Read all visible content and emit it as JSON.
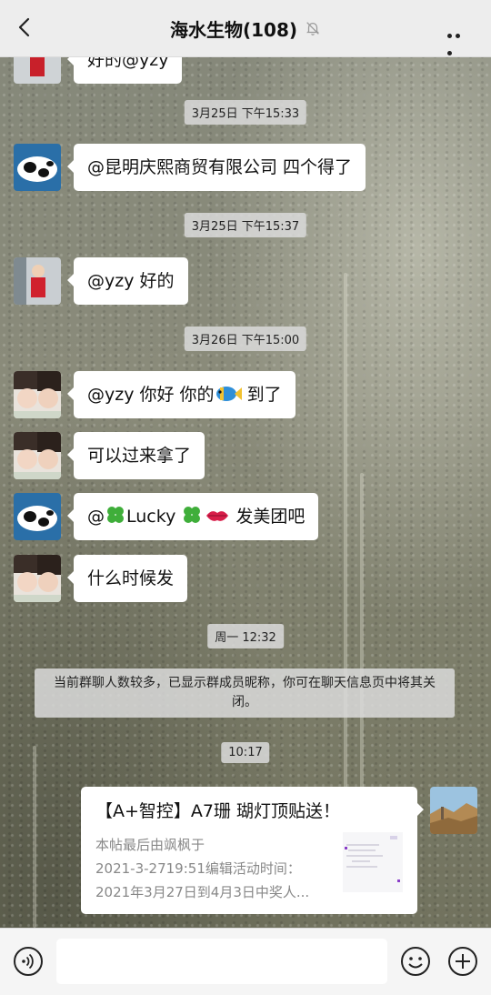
{
  "header": {
    "title": "海水生物(108)"
  },
  "messages": {
    "partial_text": "好的@yzy",
    "ts1": "3月25日 下午15:33",
    "m1": "@昆明庆熙商贸有限公司  四个得了",
    "ts2": "3月25日 下午15:37",
    "m2": "@yzy  好的",
    "ts3": "3月26日 下午15:00",
    "m3a": "@yzy  你好 你的",
    "m3b": " 到了",
    "m4": "可以过来拿了",
    "m5a": "@",
    "m5b": "Lucky ",
    "m5c": "  发美团吧",
    "m6": "什么时候发",
    "ts4": "周一 12:32",
    "notice": "当前群聊人数较多，已显示群成员昵称，你可在聊天信息页中将其关闭。",
    "ts5": "10:17"
  },
  "card": {
    "title": "【A+智控】A7珊 瑚灯顶贴送！",
    "desc_line1": "本帖最后由飒枫于",
    "desc_line2": "2021-3-2719:51编辑活动时间：",
    "desc_line3": "2021年3月27日到4月3日中奖人..."
  },
  "colors": {
    "header_bg": "#ededed",
    "bubble_bg": "#ffffff",
    "timestamp_bg": "#dadada"
  }
}
